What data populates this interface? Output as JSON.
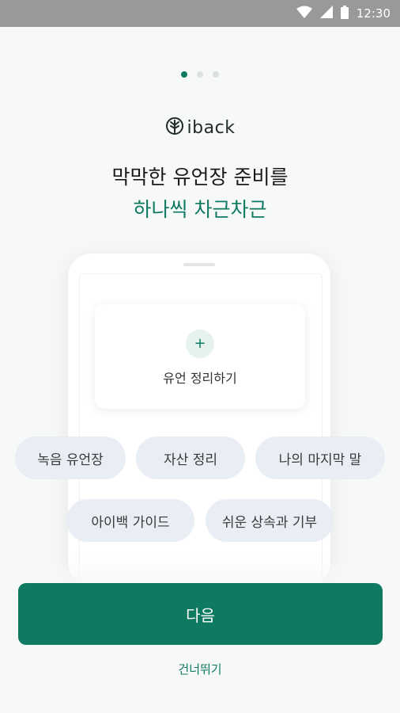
{
  "status_bar": {
    "time": "12:30",
    "icons": [
      "wifi-icon",
      "signal-icon",
      "battery-icon"
    ]
  },
  "onboarding": {
    "page_indicator": {
      "current": 1,
      "total": 3
    },
    "logo_text": "iback",
    "title_line1": "막막한 유언장 준비를",
    "title_line2": "하나씩 차근차근"
  },
  "preview": {
    "card_label": "유언 정리하기",
    "chips": [
      "녹음 유언장",
      "자산 정리",
      "나의 마지막 말",
      "아이백 가이드",
      "쉬운 상속과 기부"
    ]
  },
  "actions": {
    "next_label": "다음",
    "skip_label": "건너뛰기"
  },
  "colors": {
    "accent": "#0e7a62",
    "chip_bg": "#e9edf4",
    "status_bar": "#999999"
  }
}
